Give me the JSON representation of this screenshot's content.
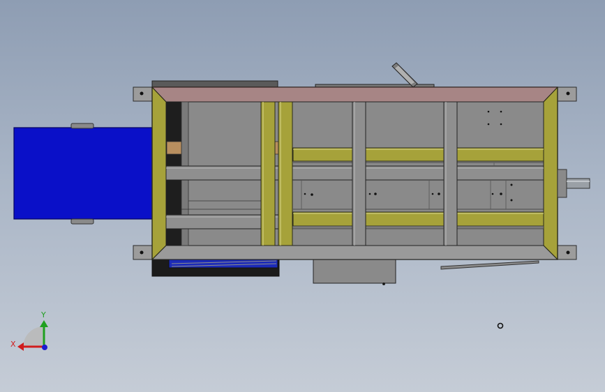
{
  "viewport": {
    "background_top": "#8e9db3",
    "background_bottom": "#c5ccd6"
  },
  "model": {
    "frame_color": "#a6a23a",
    "top_rail_color": "#a78585",
    "panel_color": "#8a8a8a",
    "crossbar_color": "#8f8f8f",
    "motor_color": "#0a10c8",
    "shaft_color": "#9aa0a6"
  },
  "triad": {
    "x_label": "X",
    "y_label": "Y",
    "x_color": "#d01c1c",
    "y_color": "#1fa01f",
    "z_color": "#1c1cd0"
  }
}
